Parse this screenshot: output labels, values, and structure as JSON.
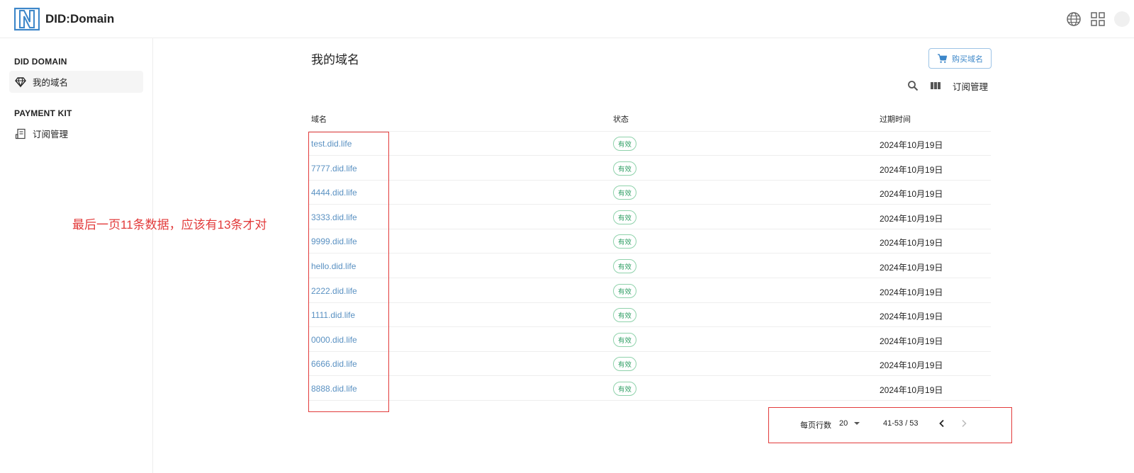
{
  "header": {
    "app_title": "DID:Domain",
    "icons": [
      "logo-icon",
      "globe-icon",
      "apps-grid-icon",
      "avatar"
    ]
  },
  "sidebar": {
    "sections": [
      {
        "heading": "DID DOMAIN",
        "items": [
          {
            "label": "我的域名",
            "icon": "diamond-icon",
            "active": true
          }
        ]
      },
      {
        "heading": "PAYMENT KIT",
        "items": [
          {
            "label": "订阅管理",
            "icon": "receipt-icon",
            "active": false
          }
        ]
      }
    ]
  },
  "main": {
    "title": "我的域名",
    "buy_button": "购买域名",
    "subscription_link": "订阅管理",
    "table": {
      "columns": [
        "域名",
        "状态",
        "过期时间"
      ],
      "rows": [
        {
          "domain": "test.did.life",
          "status": "有效",
          "expires": "2024年10月19日"
        },
        {
          "domain": "7777.did.life",
          "status": "有效",
          "expires": "2024年10月19日"
        },
        {
          "domain": "4444.did.life",
          "status": "有效",
          "expires": "2024年10月19日"
        },
        {
          "domain": "3333.did.life",
          "status": "有效",
          "expires": "2024年10月19日"
        },
        {
          "domain": "9999.did.life",
          "status": "有效",
          "expires": "2024年10月19日"
        },
        {
          "domain": "hello.did.life",
          "status": "有效",
          "expires": "2024年10月19日"
        },
        {
          "domain": "2222.did.life",
          "status": "有效",
          "expires": "2024年10月19日"
        },
        {
          "domain": "1111.did.life",
          "status": "有效",
          "expires": "2024年10月19日"
        },
        {
          "domain": "0000.did.life",
          "status": "有效",
          "expires": "2024年10月19日"
        },
        {
          "domain": "6666.did.life",
          "status": "有效",
          "expires": "2024年10月19日"
        },
        {
          "domain": "8888.did.life",
          "status": "有效",
          "expires": "2024年10月19日"
        }
      ]
    },
    "pagination": {
      "rows_per_page_label": "每页行数",
      "rows_per_page": "20",
      "range": "41-53 / 53"
    }
  },
  "annotation": {
    "text": "最后一页11条数据，应该有13条才对",
    "color": "#e23b3b"
  },
  "colors": {
    "link": "#5a91c2",
    "status_green": "#2e9e63",
    "accent_blue": "#3d87c9"
  }
}
